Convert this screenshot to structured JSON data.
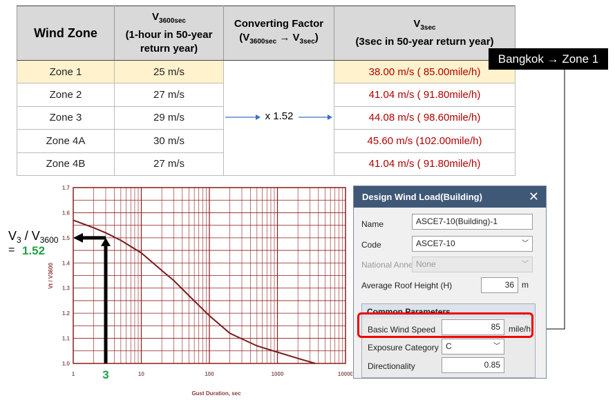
{
  "table": {
    "headers": {
      "zone": "Wind Zone",
      "v3600_main": "V",
      "v3600_sub": "3600sec",
      "v3600_desc": "(1-hour in 50-year return year)",
      "factor_title": "Converting Factor",
      "factor_a": "V",
      "factor_a_sub": "3600sec",
      "factor_arrow": "→",
      "factor_b": "V",
      "factor_b_sub": "3sec",
      "v3_main": "V",
      "v3_sub": "3sec",
      "v3_desc": "(3sec in 50-year return year)"
    },
    "factor": "x 1.52",
    "rows": [
      {
        "zone": "Zone 1",
        "v3600": "25 m/s",
        "v3": "38.00 m/s ( 85.00mile/h)",
        "highlight": true
      },
      {
        "zone": "Zone 2",
        "v3600": "27 m/s",
        "v3": "41.04 m/s ( 91.80mile/h)"
      },
      {
        "zone": "Zone 3",
        "v3600": "29 m/s",
        "v3": "44.08 m/s ( 98.60mile/h)"
      },
      {
        "zone": "Zone 4A",
        "v3600": "30 m/s",
        "v3": "45.60 m/s (102.00mile/h)"
      },
      {
        "zone": "Zone 4B",
        "v3600": "27 m/s",
        "v3": "41.04 m/s ( 91.80mile/h)"
      }
    ],
    "highlight_color": "#fff2cc",
    "value_color": "#b00000"
  },
  "callout": "Bangkok → Zone 1",
  "annotation": {
    "ratio_a": "V",
    "ratio_a_sub": "3",
    "ratio_sep": " / V",
    "ratio_b_sub": "3600",
    "equals": "=",
    "value": "1.52",
    "x_marker": "3",
    "value_color": "#22a045"
  },
  "chart_data": {
    "type": "line",
    "xscale": "log",
    "xlim": [
      1,
      10000
    ],
    "ylim": [
      1.0,
      1.7
    ],
    "xlabel": "Gust Duration, sec",
    "ylabel": "Vt / V3600",
    "xticks": [
      "1",
      "10",
      "100",
      "1000",
      "10000"
    ],
    "yticks": [
      "1.0",
      "1.1",
      "1.2",
      "1.3",
      "1.4",
      "1.5",
      "1.6",
      "1.7"
    ],
    "grid": true,
    "color": "#8b1a1a",
    "x": [
      1,
      2,
      3,
      5,
      10,
      20,
      30,
      50,
      100,
      200,
      500,
      1000,
      2000,
      3600
    ],
    "y": [
      1.57,
      1.54,
      1.52,
      1.49,
      1.44,
      1.37,
      1.33,
      1.27,
      1.19,
      1.12,
      1.07,
      1.045,
      1.02,
      1.0
    ]
  },
  "dialog": {
    "title": "Design Wind Load(Building)",
    "name_label": "Name",
    "name_value": "ASCE7-10(Building)-1",
    "code_label": "Code",
    "code_value": "ASCE7-10",
    "annex_label": "National Annex",
    "annex_value": "None",
    "height_label": "Average Roof Height (H)",
    "height_value": "36",
    "height_unit": "m",
    "group_title": "Common Parameters",
    "speed_label": "Basic Wind Speed",
    "speed_value": "85",
    "speed_unit": "mile/h",
    "exposure_label": "Exposure Category",
    "exposure_value": "C",
    "dir_label": "Directionality",
    "dir_value": "0.85"
  }
}
